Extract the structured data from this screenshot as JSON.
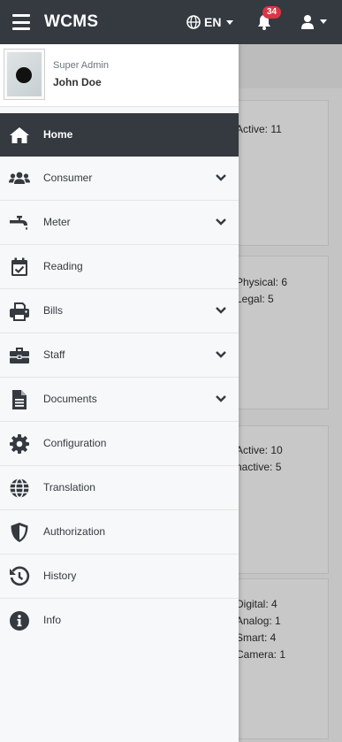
{
  "topbar": {
    "title": "WCMS",
    "language": "EN",
    "notification_count": "34"
  },
  "profile": {
    "role": "Super Admin",
    "name": "John Doe"
  },
  "menu": [
    {
      "label": "Home",
      "icon": "home-icon",
      "active": true,
      "expandable": false
    },
    {
      "label": "Consumer",
      "icon": "users-icon",
      "expandable": true
    },
    {
      "label": "Meter",
      "icon": "faucet-icon",
      "expandable": true
    },
    {
      "label": "Reading",
      "icon": "calendar-check-icon",
      "expandable": false
    },
    {
      "label": "Bills",
      "icon": "printer-icon",
      "expandable": true
    },
    {
      "label": "Staff",
      "icon": "briefcase-icon",
      "expandable": true
    },
    {
      "label": "Documents",
      "icon": "file-icon",
      "expandable": true
    },
    {
      "label": "Configuration",
      "icon": "gear-icon",
      "expandable": false
    },
    {
      "label": "Translation",
      "icon": "globe-icon",
      "expandable": false
    },
    {
      "label": "Authorization",
      "icon": "shield-icon",
      "expandable": false
    },
    {
      "label": "History",
      "icon": "history-icon",
      "expandable": false
    },
    {
      "label": "Info",
      "icon": "info-icon",
      "expandable": false
    }
  ],
  "background_cards": [
    {
      "lines": [
        "Active: 11"
      ]
    },
    {
      "lines": [
        "Physical: 6",
        "Legal: 5"
      ]
    },
    {
      "lines": [
        "Active: 10",
        "nactive: 5"
      ]
    },
    {
      "lines": [
        "Digital: 4",
        "Analog: 1",
        "Smart: 4",
        "Camera: 1"
      ]
    }
  ],
  "colors": {
    "topbar": "#343a40",
    "badge": "#dc3545",
    "drawer": "#f7f8f9"
  }
}
